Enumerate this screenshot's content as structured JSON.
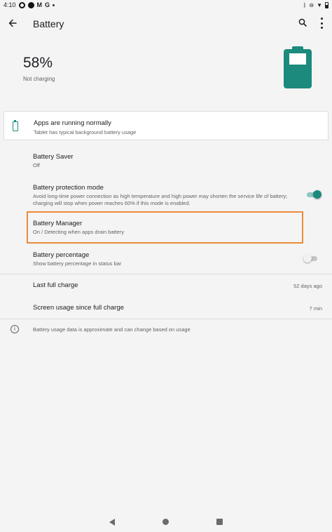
{
  "status_bar": {
    "time": "4:10",
    "left_icons": [
      "cloud-icon",
      "dot-icon",
      "ring-icon",
      "gmail-icon",
      "google-icon",
      "dot-icon"
    ],
    "right_icons": [
      "bluetooth-icon",
      "do-not-disturb-icon",
      "wifi-icon",
      "battery-icon"
    ]
  },
  "toolbar": {
    "title": "Battery",
    "back_icon": "arrow-left-icon",
    "search_icon": "search-icon",
    "more_icon": "more-vert-icon"
  },
  "hero": {
    "percentage": "58%",
    "status": "Not charging",
    "battery_level": 0.58,
    "battery_color": "#1c8a7d"
  },
  "alert_card": {
    "title": "Apps are running normally",
    "subtitle": "Tablet has typical background battery usage"
  },
  "settings": [
    {
      "title": "Battery Saver",
      "subtitle": "Off"
    },
    {
      "title": "Battery protection mode",
      "subtitle": "Avoid long-time power connection as high temperature and high power may shorten the service life of battery; charging will stop when power reaches 60% if this mode is enabled.",
      "toggle": true
    },
    {
      "title": "Battery Manager",
      "subtitle": "On / Detecting when apps drain battery"
    },
    {
      "title": "Battery percentage",
      "subtitle": "Show battery percentage in status bar",
      "toggle": false
    }
  ],
  "usage": [
    {
      "label": "Last full charge",
      "value": "52 days ago"
    },
    {
      "label": "Screen usage since full charge",
      "value": "7 min"
    }
  ],
  "footer_info": {
    "icon": "info-icon",
    "text": "Battery usage data is approximate and can change based on usage"
  },
  "nav_bar": [
    "back-triangle-icon",
    "home-circle-icon",
    "recents-square-icon"
  ],
  "colors": {
    "accent": "#1c8a7d",
    "highlight": "#ea8a3a",
    "background": "#f4f4f4"
  }
}
